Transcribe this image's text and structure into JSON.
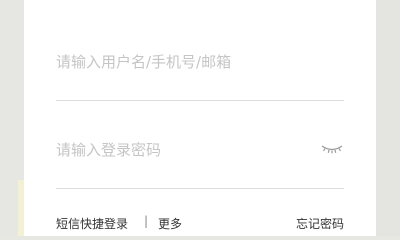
{
  "login": {
    "username_placeholder": "请输入用户名/手机号/邮箱",
    "password_placeholder": "请输入登录密码",
    "password_toggle_icon": "eye-closed-icon"
  },
  "footer": {
    "sms_login_label": "短信快捷登录",
    "separator": "|",
    "more_label": "更多",
    "forgot_password_label": "忘记密码"
  }
}
